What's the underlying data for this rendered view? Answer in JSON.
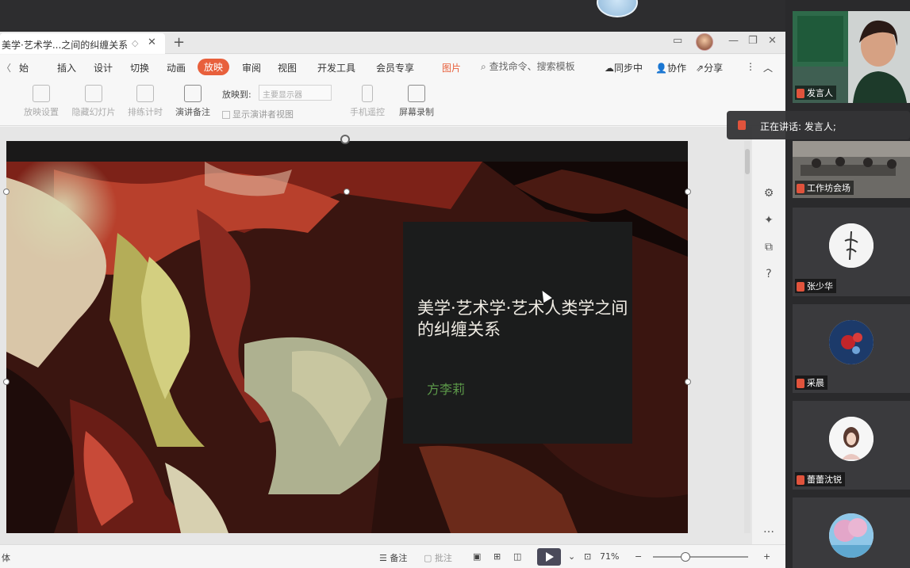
{
  "window": {
    "doc_title": "美学·艺术学...之间的纠缠关系"
  },
  "menu": {
    "items": [
      "插入",
      "设计",
      "切换",
      "动画",
      "放映",
      "审阅",
      "视图",
      "开发工具",
      "会员专享"
    ],
    "active": "放映",
    "partial_first": "始",
    "pic_label": "图片",
    "search_placeholder": "查找命令、搜索模板",
    "sync": "同步中",
    "collab": "协作",
    "share": "分享"
  },
  "toolbar": {
    "tools": [
      "放映设置",
      "隐藏幻灯片",
      "排练计时",
      "演讲备注",
      "手机遥控",
      "屏幕录制"
    ],
    "monitor_label": "放映到:",
    "monitor_value": "主要显示器",
    "presenter_view": "显示演讲者视图"
  },
  "slide": {
    "title": "美学·艺术学·艺术人类学之间的纠缠关系",
    "author": "方李莉"
  },
  "statusbar": {
    "left": "体",
    "notes": "备注",
    "comment": "批注",
    "zoom": "71%"
  },
  "participants": {
    "speaking_toast": "正在讲话: 发言人;",
    "tiles": [
      {
        "name": "发言人",
        "kind": "video-woman"
      },
      {
        "name": "工作坊会场",
        "kind": "video-room"
      },
      {
        "name": "张少华",
        "kind": "avatar-ink"
      },
      {
        "name": "采晨",
        "kind": "avatar-flower"
      },
      {
        "name": "蕾蕾沈锐",
        "kind": "avatar-girl"
      },
      {
        "name": "",
        "kind": "avatar-blossom"
      }
    ]
  },
  "colors": {
    "accent": "#e8603c",
    "author_text": "#5d9a4a",
    "mic_red": "#e0533c"
  }
}
